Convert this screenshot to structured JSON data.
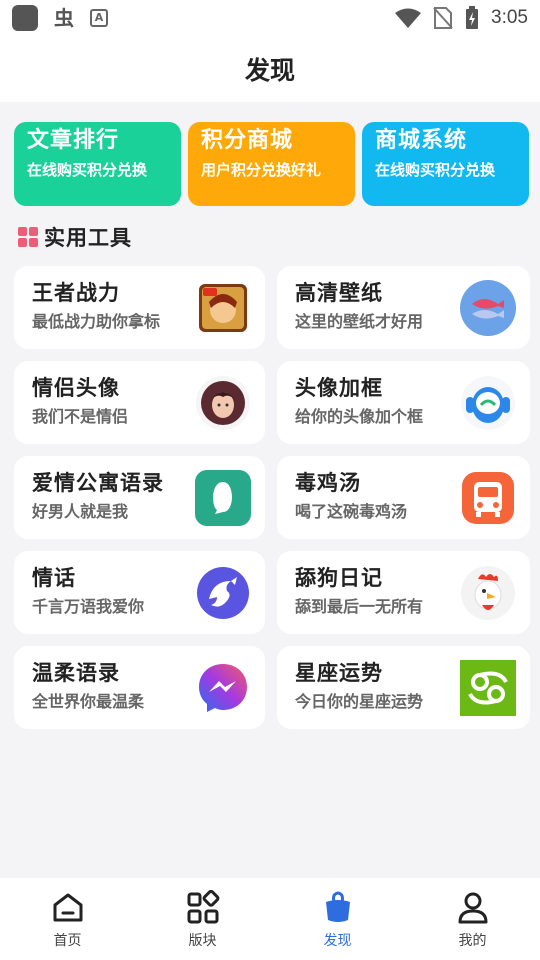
{
  "status_bar": {
    "time": "3:05",
    "sb_text": "A"
  },
  "header": {
    "title": "发现"
  },
  "features": [
    {
      "title": "文章排行",
      "desc": "在线购买积分兑换",
      "color": "#1ad19a"
    },
    {
      "title": "积分商城",
      "desc": "用户积分兑换好礼",
      "color": "#ffa809"
    },
    {
      "title": "商城系统",
      "desc": "在线购买积分兑换",
      "color": "#12b8f0"
    }
  ],
  "section": {
    "title": "实用工具"
  },
  "tools": [
    {
      "title": "王者战力",
      "desc": "最低战力助你拿标",
      "icon": "game-avatar-icon"
    },
    {
      "title": "高清壁纸",
      "desc": "这里的壁纸才好用",
      "icon": "fish-icon"
    },
    {
      "title": "情侣头像",
      "desc": "我们不是情侣",
      "icon": "girl-avatar-icon"
    },
    {
      "title": "头像加框",
      "desc": "给你的头像加个框",
      "icon": "robot-icon"
    },
    {
      "title": "爱情公寓语录",
      "desc": "好男人就是我",
      "icon": "chat-bubble-icon"
    },
    {
      "title": "毒鸡汤",
      "desc": "喝了这碗毒鸡汤",
      "icon": "bus-icon"
    },
    {
      "title": "情话",
      "desc": "千言万语我爱你",
      "icon": "dolphin-icon"
    },
    {
      "title": "舔狗日记",
      "desc": "舔到最后一无所有",
      "icon": "rooster-icon"
    },
    {
      "title": "温柔语录",
      "desc": "全世界你最温柔",
      "icon": "messenger-icon"
    },
    {
      "title": "星座运势",
      "desc": "今日你的星座运势",
      "icon": "cancer-zodiac-icon"
    }
  ],
  "tabbar": {
    "items": [
      {
        "label": "首页"
      },
      {
        "label": "版块"
      },
      {
        "label": "发现"
      },
      {
        "label": "我的"
      }
    ],
    "active_color": "#2d6de0"
  }
}
